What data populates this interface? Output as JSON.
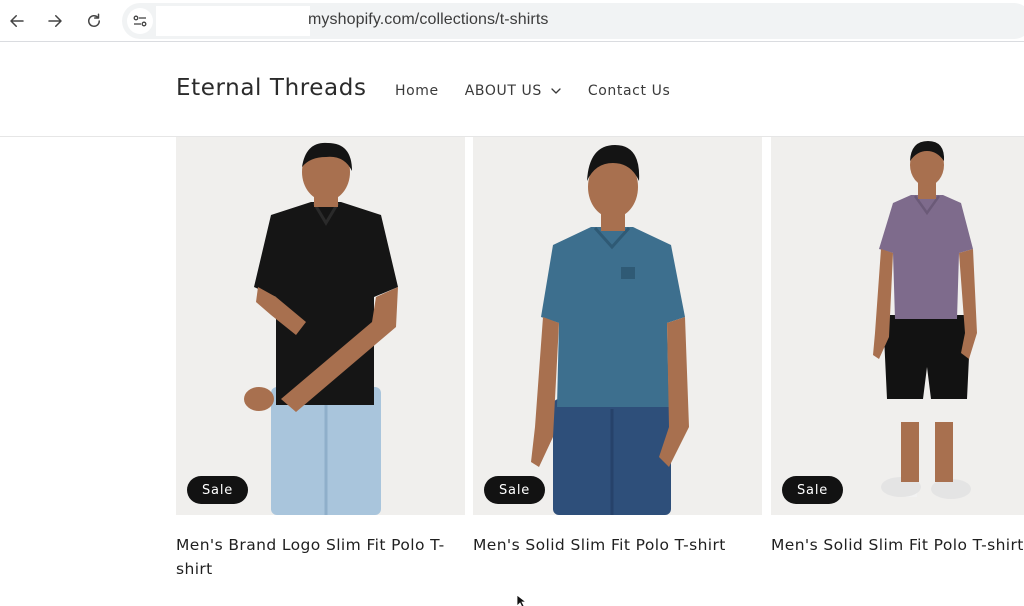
{
  "browser": {
    "url": "myshopify.com/collections/t-shirts",
    "icons": [
      "back-arrow-icon",
      "forward-arrow-icon",
      "reload-icon",
      "site-settings-icon"
    ]
  },
  "store": {
    "title": "Eternal Threads",
    "nav": [
      {
        "label": "Home"
      },
      {
        "label": "ABOUT US",
        "dropdown": true
      },
      {
        "label": "Contact Us"
      }
    ]
  },
  "products": [
    {
      "title": "Men's Brand Logo Slim Fit Polo T-shirt",
      "badge": "Sale",
      "shirt_color": "#151515",
      "bottom_color": "#a9c5dc",
      "bottom": "jeans"
    },
    {
      "title": "Men's Solid Slim Fit Polo T-shirt",
      "badge": "Sale",
      "shirt_color": "#3d6f8e",
      "bottom_color": "#2e4f7a",
      "bottom": "jeans"
    },
    {
      "title": "Men's Solid Slim Fit Polo T-shirt",
      "badge": "Sale",
      "shirt_color": "#7e6b8c",
      "bottom_color": "#121212",
      "bottom": "shorts"
    }
  ],
  "colors": {
    "badge_bg": "#121212",
    "media_bg": "#f0efed",
    "skin": "#a8704f"
  }
}
